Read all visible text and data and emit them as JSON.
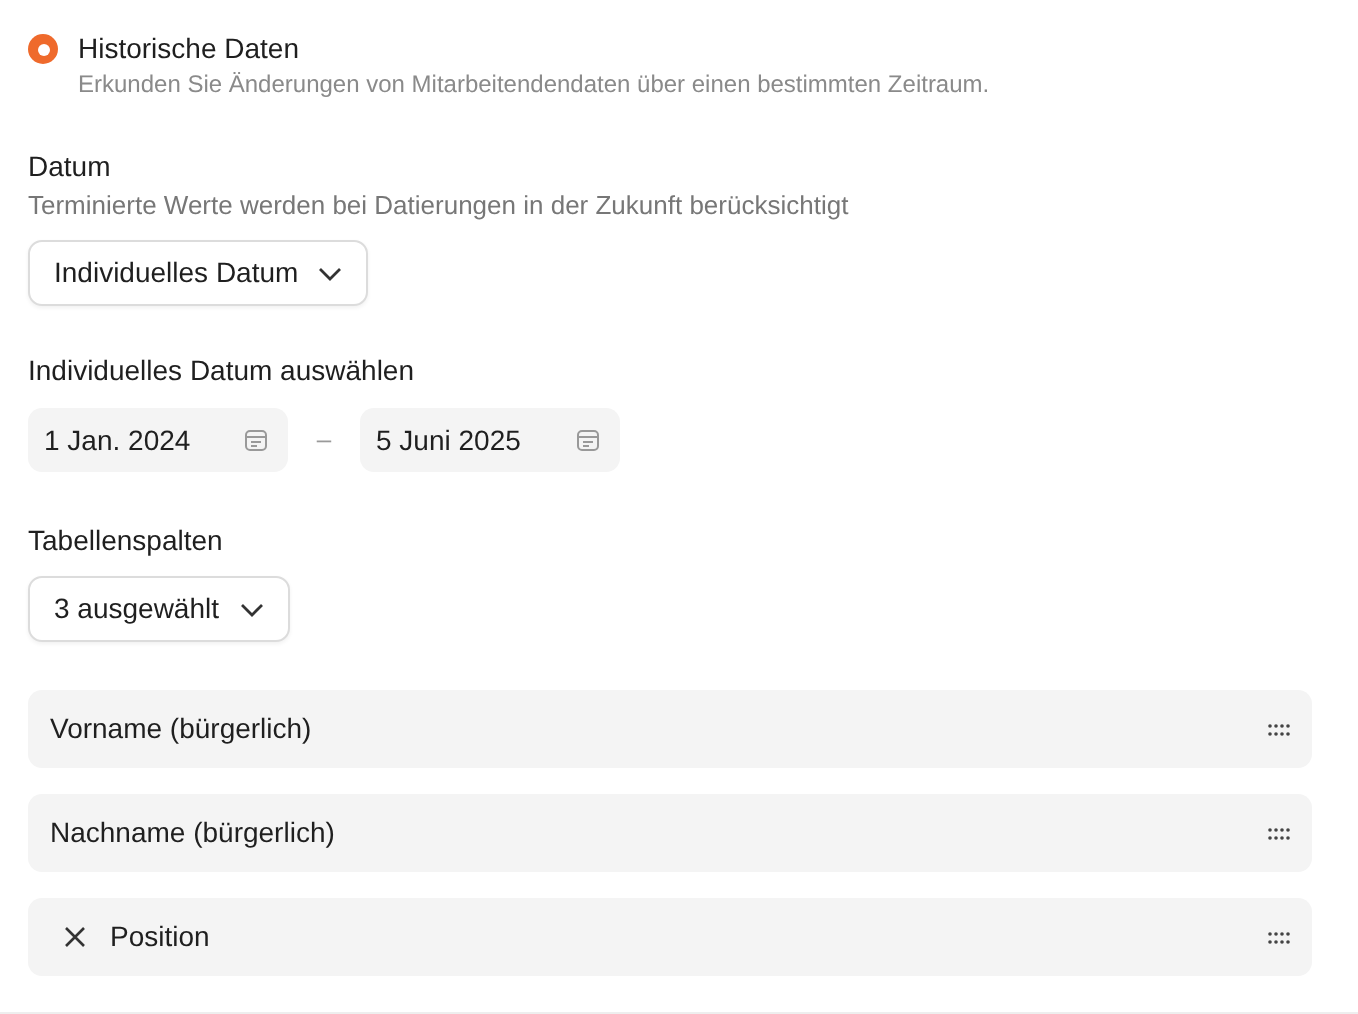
{
  "radio": {
    "label": "Historische Daten",
    "description": "Erkunden Sie Änderungen von Mitarbeitendendaten über einen bestimmten Zeitraum.",
    "selected": true
  },
  "date_section": {
    "label": "Datum",
    "hint": "Terminierte Werte werden bei Datierungen in der Zukunft berücksichtigt",
    "dropdown": "Individuelles Datum"
  },
  "custom_date": {
    "label": "Individuelles Datum auswählen",
    "start": "1 Jan. 2024",
    "separator": "–",
    "end": "5 Juni 2025"
  },
  "columns_section": {
    "label": "Tabellenspalten",
    "dropdown": "3 ausgewählt",
    "items": [
      {
        "label": "Vorname (bürgerlich)",
        "removable": false
      },
      {
        "label": "Nachname (bürgerlich)",
        "removable": false
      },
      {
        "label": "Position",
        "removable": true
      }
    ]
  }
}
